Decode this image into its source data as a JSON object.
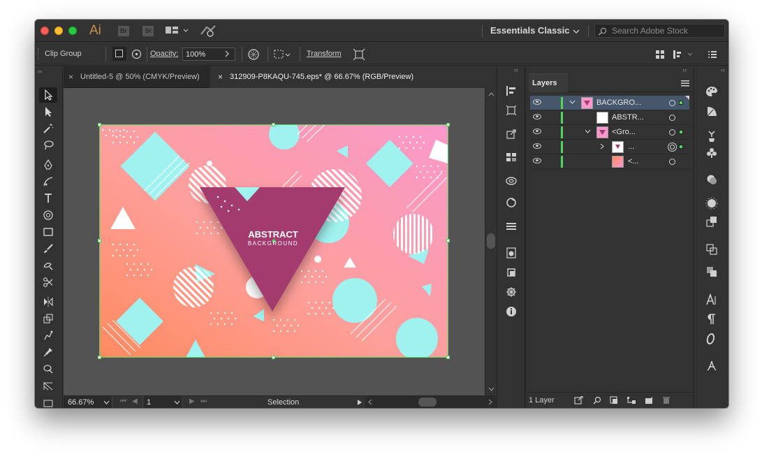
{
  "titlebar": {
    "app_logo": "Ai",
    "bridge_label": "Br",
    "stock_label": "St",
    "workspace": "Essentials Classic",
    "search_placeholder": "Search Adobe Stock"
  },
  "control_bar": {
    "selection_type": "Clip Group",
    "opacity_label": "Opacity:",
    "opacity_value": "100%",
    "transform_label": "Transform"
  },
  "tabs": [
    {
      "label": "Untitled-5 @ 50% (CMYK/Preview)",
      "active": false
    },
    {
      "label": "312909-P8KAQU-745.eps* @ 66.67% (RGB/Preview)",
      "active": true
    }
  ],
  "artboard": {
    "title": "ABSTRACT",
    "subtitle": "BACKGROUND",
    "gradient_colors": [
      "#fd9f9b",
      "#fc98cc",
      "#ff8a5f"
    ],
    "shape_color": "#9ff2ef",
    "triangle_color": "#a33a6e"
  },
  "status": {
    "zoom": "66.67%",
    "artboard_number": "1",
    "tool": "Selection"
  },
  "layers": {
    "title": "Layers",
    "rows": [
      {
        "name": "BACKGRO...",
        "expanded": true,
        "selected": true
      },
      {
        "name": "ABSTR..."
      },
      {
        "name": "<Gro...",
        "expanded": true
      },
      {
        "name": "...",
        "expanded": false
      },
      {
        "name": "<..."
      }
    ],
    "footer": "1 Layer"
  },
  "colors": {
    "app_bg": "#323232",
    "canvas_bg": "#535353",
    "selection_green": "#4fd65c",
    "selected_row": "#46566b"
  }
}
